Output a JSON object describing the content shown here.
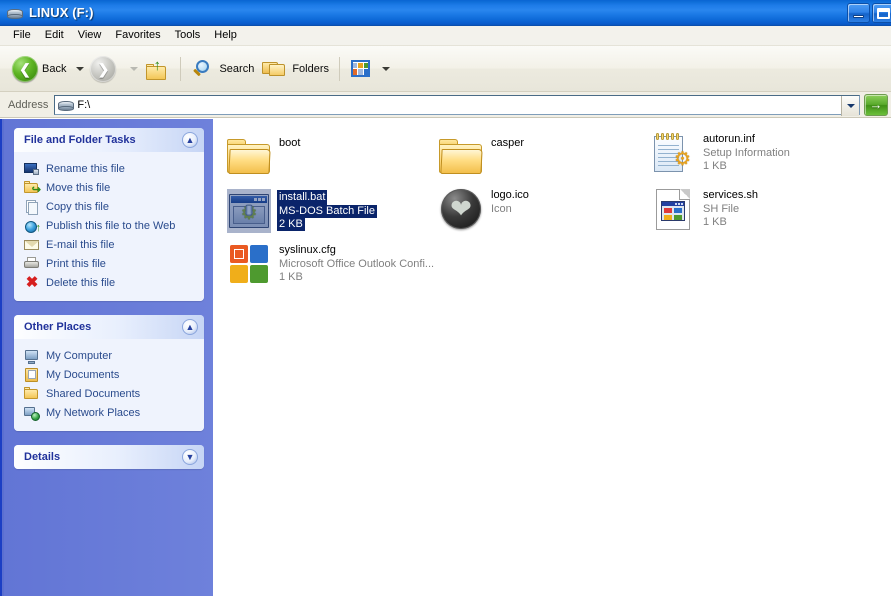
{
  "window": {
    "title": "LINUX (F:)",
    "title_icon": "cd-drive-icon",
    "minimize_label": "Minimize",
    "maximize_label": "Maximize"
  },
  "menubar": {
    "items": [
      {
        "label": "File"
      },
      {
        "label": "Edit"
      },
      {
        "label": "View"
      },
      {
        "label": "Favorites"
      },
      {
        "label": "Tools"
      },
      {
        "label": "Help"
      }
    ]
  },
  "toolbar": {
    "back_label": "Back",
    "forward_label": "",
    "up_label": "",
    "search_label": "Search",
    "folders_label": "Folders",
    "views_label": ""
  },
  "address": {
    "label": "Address",
    "value": "F:\\",
    "placeholder": "F:\\",
    "go_label": "→"
  },
  "sidebar": {
    "panels": [
      {
        "title": "File and Folder Tasks",
        "collapse_state": "expanded",
        "chevron": "chevron-up-icon",
        "tasks": [
          {
            "label": "Rename this file",
            "icon": "rename-icon"
          },
          {
            "label": "Move this file",
            "icon": "move-folder-icon"
          },
          {
            "label": "Copy this file",
            "icon": "copy-document-icon"
          },
          {
            "label": "Publish this file to the Web",
            "icon": "globe-publish-icon"
          },
          {
            "label": "E-mail this file",
            "icon": "email-icon"
          },
          {
            "label": "Print this file",
            "icon": "printer-icon"
          },
          {
            "label": "Delete this file",
            "icon": "delete-x-icon"
          }
        ]
      },
      {
        "title": "Other Places",
        "collapse_state": "expanded",
        "chevron": "chevron-up-icon",
        "tasks": [
          {
            "label": "My Computer",
            "icon": "my-computer-icon"
          },
          {
            "label": "My Documents",
            "icon": "my-documents-icon"
          },
          {
            "label": "Shared Documents",
            "icon": "shared-folder-icon"
          },
          {
            "label": "My Network Places",
            "icon": "network-places-icon"
          }
        ]
      },
      {
        "title": "Details",
        "collapse_state": "collapsed",
        "chevron": "chevron-down-icon",
        "tasks": []
      }
    ]
  },
  "content": {
    "view_mode": "tiles",
    "items": [
      {
        "name": "boot",
        "type": "",
        "size": "",
        "icon": "folder-icon",
        "selected": false
      },
      {
        "name": "casper",
        "type": "",
        "size": "",
        "icon": "folder-icon",
        "selected": false
      },
      {
        "name": "autorun.inf",
        "type": "Setup Information",
        "size": "1 KB",
        "icon": "setup-information-icon",
        "selected": false
      },
      {
        "name": "install.bat",
        "type": "MS-DOS Batch File",
        "size": "2 KB",
        "icon": "batch-file-icon",
        "selected": true
      },
      {
        "name": "logo.ico",
        "type": "Icon",
        "size": "",
        "icon": "icon-file-icon",
        "selected": false
      },
      {
        "name": "services.sh",
        "type": "SH File",
        "size": "1 KB",
        "icon": "sh-file-icon",
        "selected": false
      },
      {
        "name": "syslinux.cfg",
        "type": "Microsoft Office Outlook Confi...",
        "size": "1 KB",
        "icon": "ms-office-icon",
        "selected": false
      }
    ]
  },
  "colors": {
    "titlebar_blue": "#2a86ee",
    "sidebar_blue": "#6c7fd8",
    "panel_header": "#e8effd",
    "link_blue": "#2a4b8d",
    "selection_blue": "#0a246a",
    "go_green": "#59a92b"
  }
}
